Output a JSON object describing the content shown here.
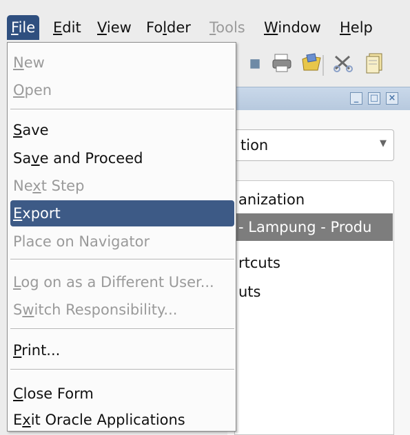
{
  "menubar": {
    "items": [
      {
        "label": "File",
        "mnemonic": "F",
        "rest": "ile",
        "state": "active"
      },
      {
        "label": "Edit",
        "mnemonic": "E",
        "rest": "dit",
        "state": "normal"
      },
      {
        "label": "View",
        "mnemonic": "V",
        "rest": "iew",
        "state": "normal"
      },
      {
        "label": "Folder",
        "pre": "Fo",
        "mnemonic": "l",
        "rest": "der",
        "state": "normal"
      },
      {
        "label": "Tools",
        "mnemonic": "T",
        "rest": "ools",
        "state": "disabled"
      },
      {
        "label": "Window",
        "mnemonic": "W",
        "rest": "indow",
        "state": "normal"
      },
      {
        "label": "Help",
        "mnemonic": "H",
        "rest": "elp",
        "state": "normal"
      }
    ]
  },
  "file_menu": {
    "items": [
      {
        "pre": "",
        "mnemonic": "N",
        "rest": "ew",
        "state": "disabled"
      },
      {
        "pre": "",
        "mnemonic": "O",
        "rest": "pen",
        "state": "disabled"
      },
      {
        "pre": "",
        "mnemonic": "S",
        "rest": "ave",
        "state": "normal"
      },
      {
        "pre": "Sa",
        "mnemonic": "v",
        "rest": "e and Proceed",
        "state": "normal"
      },
      {
        "pre": "Ne",
        "mnemonic": "x",
        "rest": "t Step",
        "state": "disabled"
      },
      {
        "pre": "",
        "mnemonic": "E",
        "rest": "xport",
        "state": "highlighted"
      },
      {
        "pre": "Place on Navigator",
        "mnemonic": "",
        "rest": "",
        "state": "disabled"
      },
      {
        "pre": "",
        "mnemonic": "L",
        "rest": "og on as a Different User...",
        "state": "disabled"
      },
      {
        "pre": "S",
        "mnemonic": "w",
        "rest": "itch Responsibility...",
        "state": "disabled"
      },
      {
        "pre": "",
        "mnemonic": "P",
        "rest": "rint...",
        "state": "normal"
      },
      {
        "pre": "",
        "mnemonic": "C",
        "rest": "lose Form",
        "state": "normal"
      },
      {
        "pre": "E",
        "mnemonic": "x",
        "rest": "it Oracle Applications",
        "state": "normal"
      }
    ]
  },
  "background": {
    "combo_text": "tion",
    "list_rows": [
      "anization",
      "- Lampung - Produ",
      "rtcuts",
      "uts"
    ],
    "window_buttons": [
      "_",
      "□",
      "×"
    ]
  },
  "toolbar": {
    "icons": [
      "print-icon",
      "folder-icon",
      "cut-icon",
      "copy-icon"
    ]
  },
  "colors": {
    "highlight": "#3d5a86",
    "active_menu": "#2f4f7f",
    "disabled_text": "#9a9a9a",
    "selected_row": "#7d7d7d"
  }
}
